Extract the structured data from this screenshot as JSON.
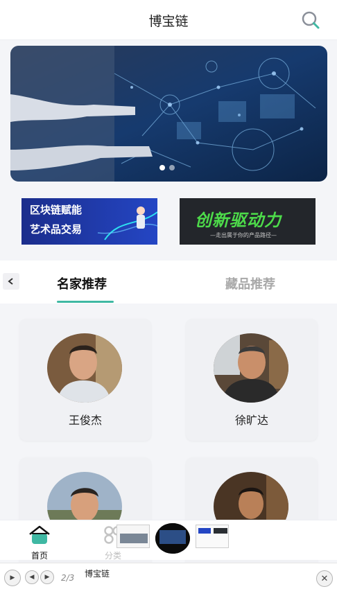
{
  "header": {
    "title": "博宝链",
    "search_icon": "search-icon"
  },
  "banner": {
    "slides": 2,
    "active_slide": 0
  },
  "promos": [
    {
      "line1": "区块链赋能",
      "line2": "艺术品交易"
    },
    {
      "line1": "创新驱动力",
      "line2": "—走出属于你的产品路径—"
    }
  ],
  "tabs": {
    "items": [
      "名家推荐",
      "藏品推荐"
    ],
    "active": 0
  },
  "artists": [
    {
      "name": "王俊杰"
    },
    {
      "name": "徐旷达"
    },
    {
      "name": ""
    },
    {
      "name": ""
    }
  ],
  "tabbar": {
    "home_label": "首页",
    "category_label": "分类"
  },
  "player": {
    "counter": "2/3",
    "title": "博宝链"
  },
  "colors": {
    "accent": "#3fb8a3",
    "background": "#f4f5f8"
  }
}
